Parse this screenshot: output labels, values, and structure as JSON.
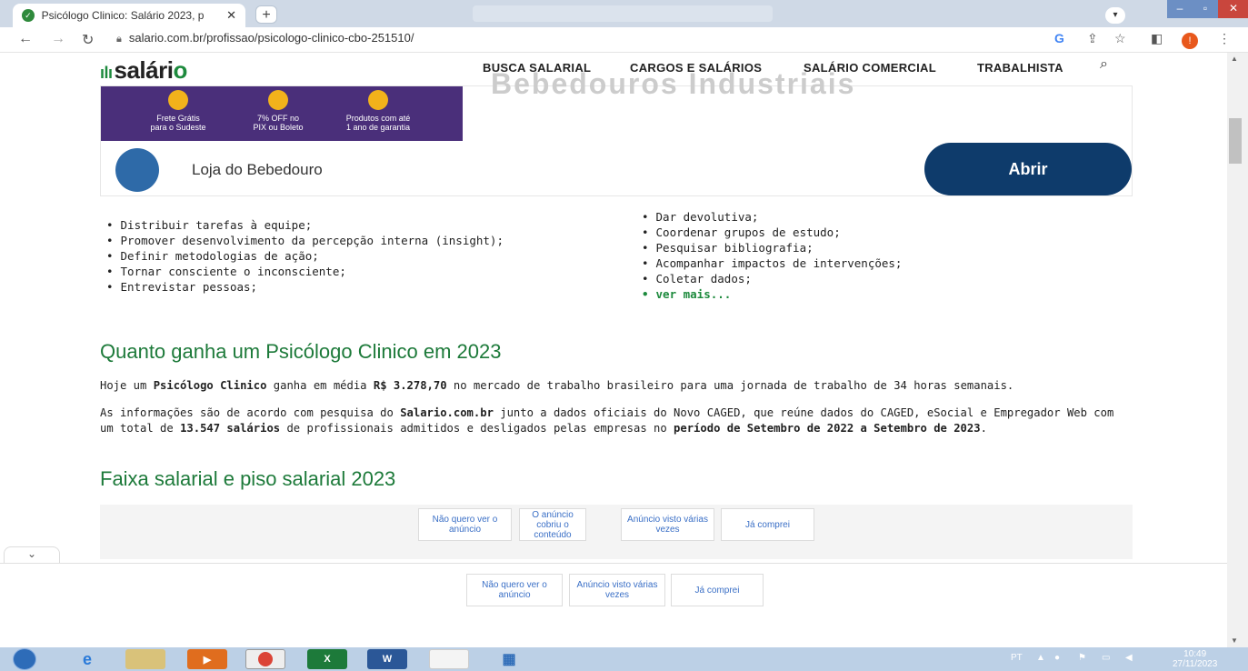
{
  "browser": {
    "tab_title": "Psicólogo Clinico: Salário 2023, p",
    "tab_close": "✕",
    "new_tab": "+",
    "url": "salario.com.br/profissao/psicologo-clinico-cbo-251510/",
    "profile_initial": "!"
  },
  "site": {
    "logo": "salári",
    "logo_o": "o",
    "nav": [
      "BUSCA SALARIAL",
      "CARGOS E SALÁRIOS",
      "SALÁRIO COMERCIAL",
      "TRABALHISTA"
    ]
  },
  "ad": {
    "ghost_text": "Bebedouros Industriais",
    "promos": [
      {
        "line1": "Frete Grátis",
        "line2": "para o Sudeste"
      },
      {
        "line1": "7% OFF no",
        "line2": "PIX ou Boleto"
      },
      {
        "line1": "Produtos com até",
        "line2": "1 ano de garantia"
      }
    ],
    "store_name": "Loja do Bebedouro",
    "open_label": "Abrir"
  },
  "tasks_left": [
    "Distribuir tarefas à equipe;",
    "Promover desenvolvimento da percepção interna (insight);",
    "Definir metodologias de ação;",
    "Tornar consciente o inconsciente;",
    "Entrevistar pessoas;"
  ],
  "tasks_right": [
    "Dar devolutiva;",
    "Coordenar grupos de estudo;",
    "Pesquisar bibliografia;",
    "Acompanhar impactos de intervenções;",
    "Coletar dados;"
  ],
  "see_more": "ver mais...",
  "section1": {
    "title": "Quanto ganha um Psicólogo Clinico em 2023",
    "p1_a": "Hoje um ",
    "p1_b": "Psicólogo Clinico",
    "p1_c": " ganha em média ",
    "p1_d": "R$ 3.278,70",
    "p1_e": " no mercado de trabalho brasileiro para uma jornada de trabalho de 34 horas semanais.",
    "p2_a": "As informações são de acordo com pesquisa do ",
    "p2_b": "Salario.com.br",
    "p2_c": " junto a dados oficiais do Novo CAGED, que reúne dados do CAGED, eSocial e Empregador Web com um total de ",
    "p2_d": "13.547 salários",
    "p2_e": " de profissionais admitidos e desligados pelas empresas no ",
    "p2_f": "período de Setembro de 2022 a Setembro de 2023",
    "p2_g": "."
  },
  "section2": {
    "title": "Faixa salarial e piso salarial 2023"
  },
  "feedback_inline": [
    "Não quero ver o anúncio",
    "O anúncio cobriu o conteúdo",
    "Anúncio visto várias vezes",
    "Já comprei"
  ],
  "feedback_bottom": [
    "Não quero ver o anúncio",
    "Anúncio visto várias vezes",
    "Já comprei"
  ],
  "taskbar": {
    "lang": "PT",
    "time": "10:49",
    "date": "27/11/2023"
  }
}
